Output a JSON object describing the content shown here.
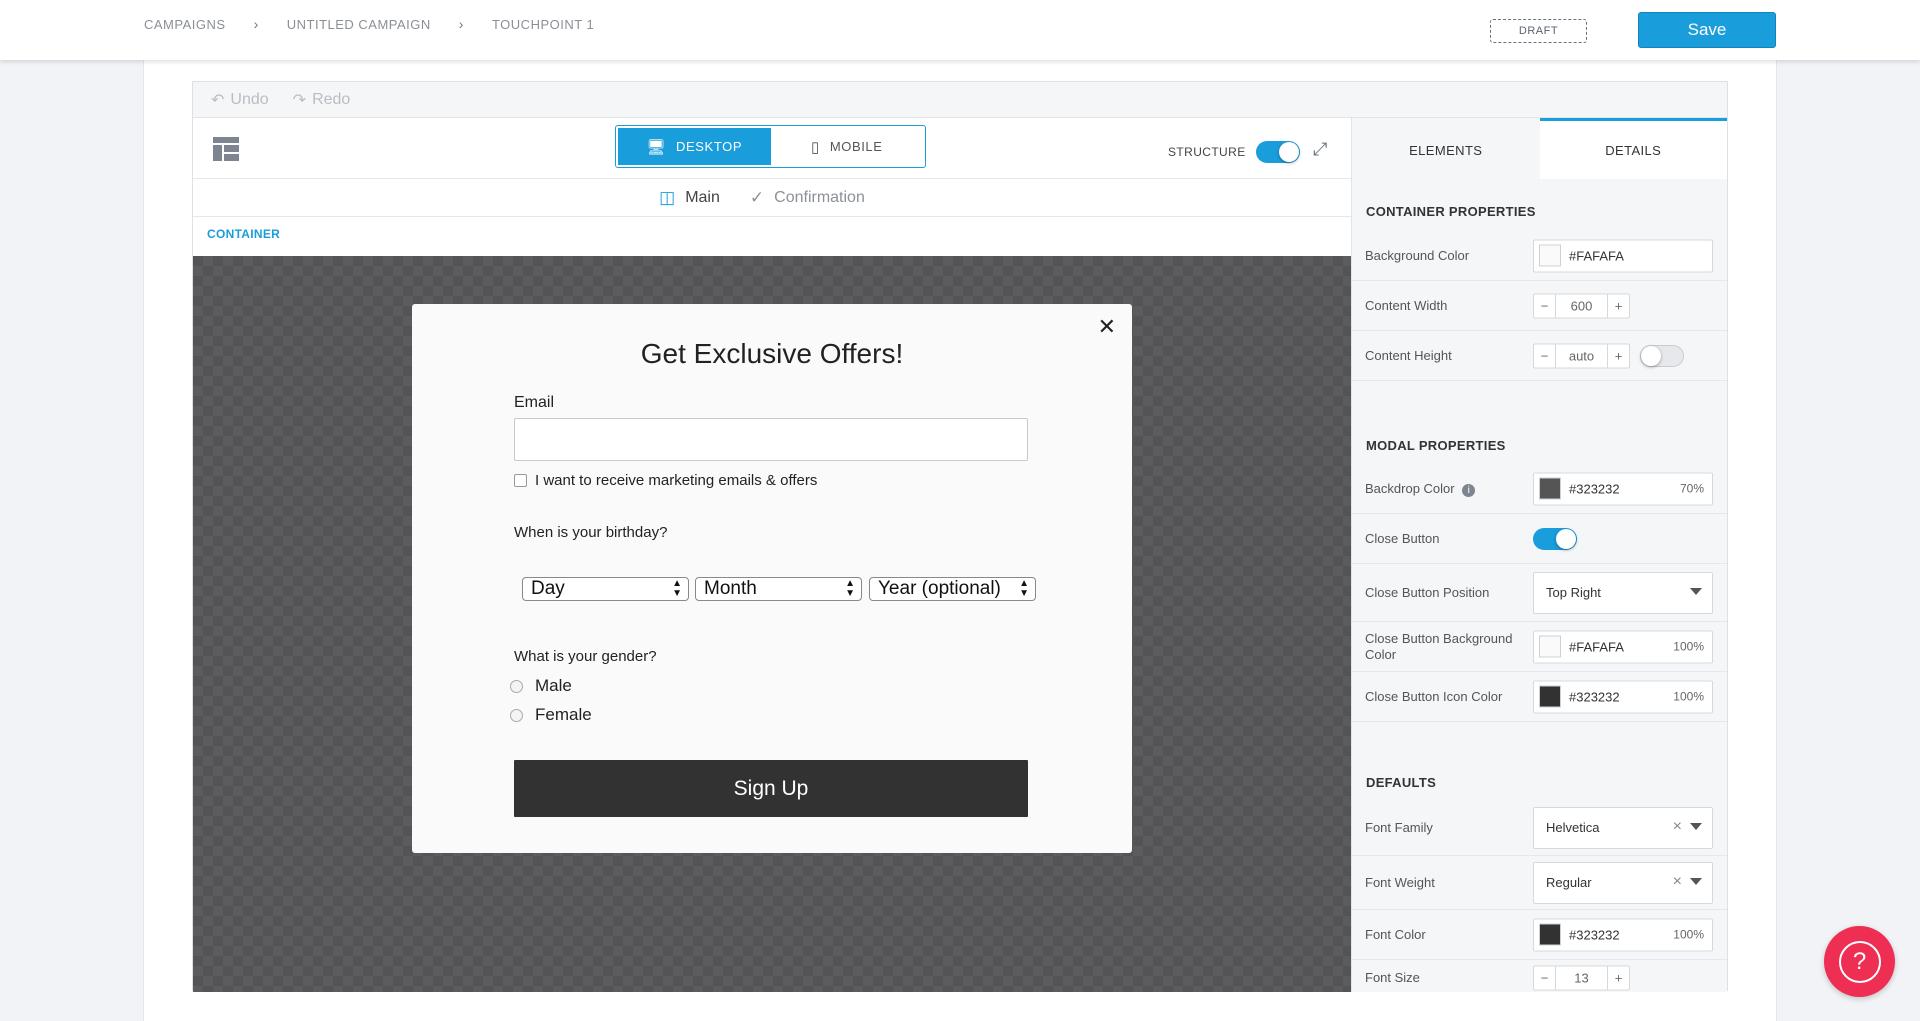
{
  "breadcrumb": [
    "CAMPAIGNS",
    "UNTITLED CAMPAIGN",
    "TOUCHPOINT 1"
  ],
  "status": "DRAFT",
  "save_label": "Save",
  "undo_label": "Undo",
  "redo_label": "Redo",
  "view_toggle": {
    "desktop": "DESKTOP",
    "mobile": "MOBILE",
    "active": "desktop"
  },
  "structure_label": "STRUCTURE",
  "page_tabs": {
    "main": "Main",
    "confirmation": "Confirmation"
  },
  "container_label": "CONTAINER",
  "modal": {
    "title": "Get Exclusive Offers!",
    "email_label": "Email",
    "email_value": "",
    "consent": "I want to receive marketing emails & offers",
    "birthday_label": "When is your birthday?",
    "day": "Day",
    "month": "Month",
    "year": "Year (optional)",
    "gender_label": "What is your gender?",
    "gender_options": [
      "Male",
      "Female"
    ],
    "submit": "Sign Up"
  },
  "panel": {
    "tabs": {
      "elements": "ELEMENTS",
      "details": "DETAILS",
      "active": "details"
    },
    "container_props": {
      "title": "CONTAINER PROPERTIES",
      "bg_label": "Background Color",
      "bg_value": "#FAFAFA",
      "width_label": "Content Width",
      "width_value": "600",
      "height_label": "Content Height",
      "height_value": "auto"
    },
    "modal_props": {
      "title": "MODAL PROPERTIES",
      "backdrop_label": "Backdrop Color",
      "backdrop_value": "#323232",
      "backdrop_pct": "70%",
      "close_label": "Close Button",
      "close_pos_label": "Close Button Position",
      "close_pos_value": "Top Right",
      "close_bg_label": "Close Button Background Color",
      "close_bg_value": "#FAFAFA",
      "close_bg_pct": "100%",
      "close_icon_label": "Close Button Icon Color",
      "close_icon_value": "#323232",
      "close_icon_pct": "100%"
    },
    "defaults": {
      "title": "DEFAULTS",
      "font_family_label": "Font Family",
      "font_family_value": "Helvetica",
      "font_weight_label": "Font Weight",
      "font_weight_value": "Regular",
      "font_color_label": "Font Color",
      "font_color_value": "#323232",
      "font_color_pct": "100%",
      "font_size_label": "Font Size",
      "font_size_value": "13"
    }
  },
  "colors": {
    "accent": "#1a9ddb",
    "help": "#ee2e52",
    "swatch_light": "#FAFAFA",
    "swatch_dark": "#323232"
  }
}
